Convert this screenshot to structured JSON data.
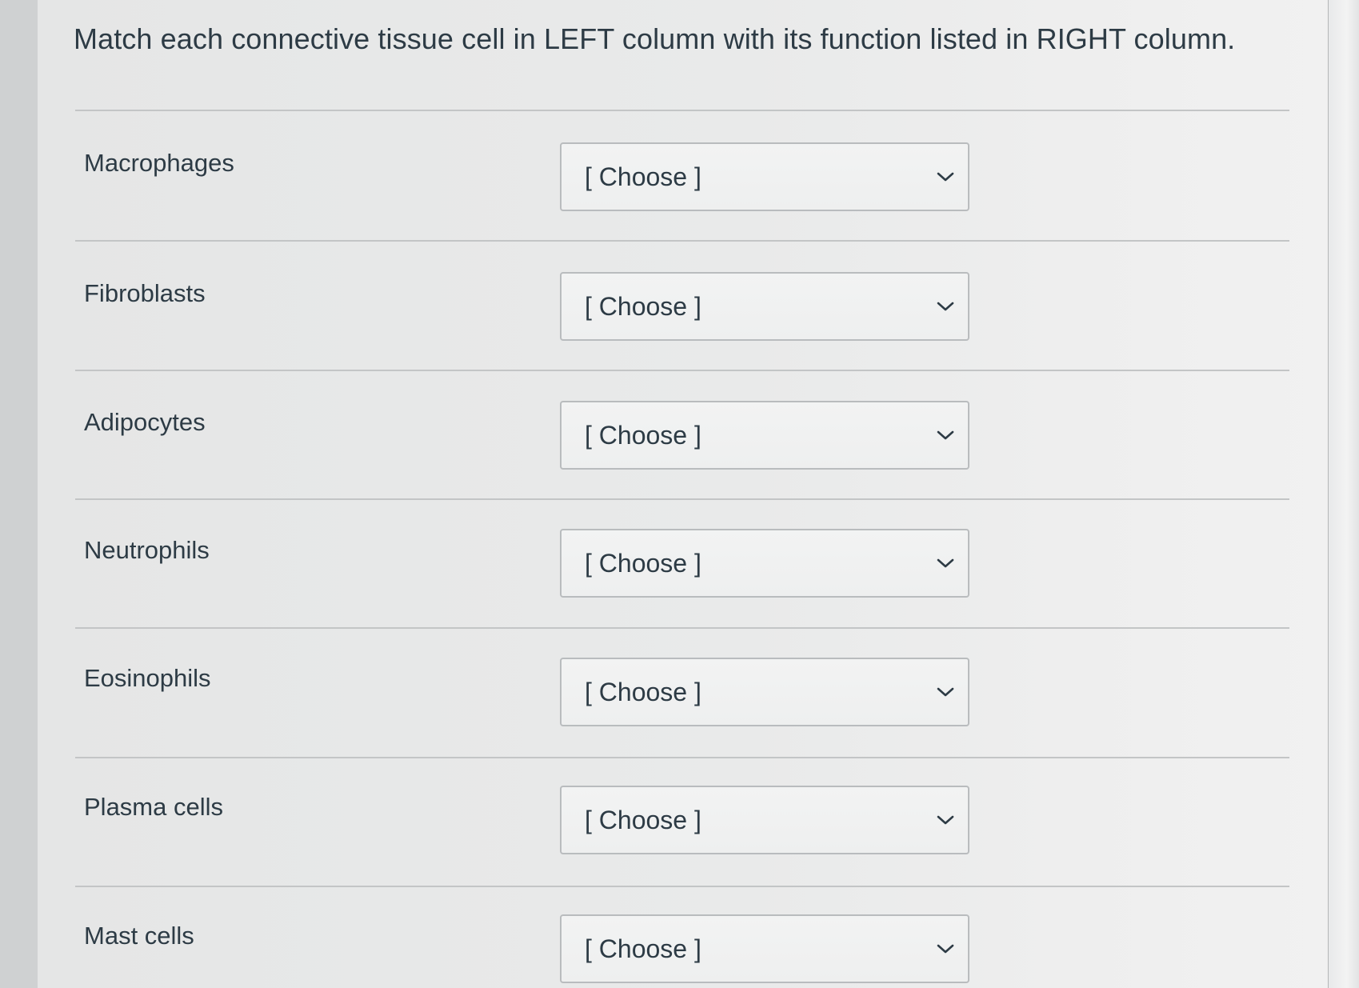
{
  "question": {
    "prompt": "Match each connective tissue cell in LEFT column with its function listed in RIGHT column."
  },
  "rows": [
    {
      "label": "Macrophages",
      "selected": "[ Choose ]"
    },
    {
      "label": "Fibroblasts",
      "selected": "[ Choose ]"
    },
    {
      "label": "Adipocytes",
      "selected": "[ Choose ]"
    },
    {
      "label": "Neutrophils",
      "selected": "[ Choose ]"
    },
    {
      "label": "Eosinophils",
      "selected": "[ Choose ]"
    },
    {
      "label": "Plasma cells",
      "selected": "[ Choose ]"
    },
    {
      "label": "Mast cells",
      "selected": "[ Choose ]"
    }
  ],
  "icons": {
    "dropdown": "chevron-down-icon"
  },
  "colors": {
    "text": "#2d3b45",
    "border": "#b9bcbe",
    "background": "#e9eaea"
  }
}
